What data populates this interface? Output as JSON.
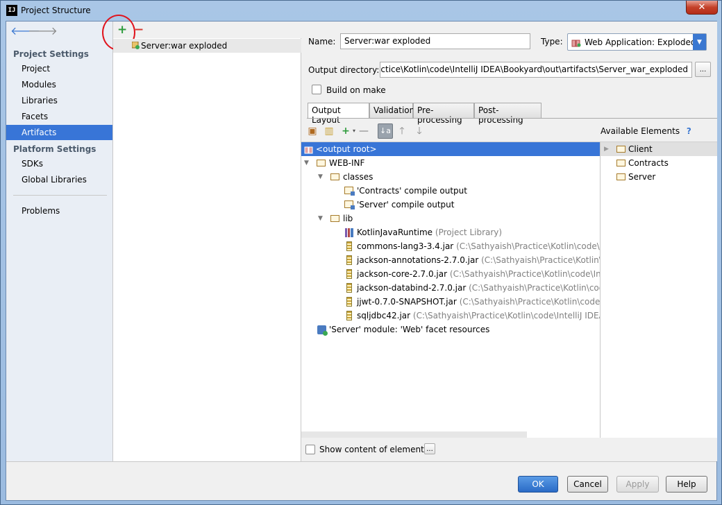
{
  "window": {
    "title": "Project Structure",
    "app_icon": "IJ",
    "close": "✕"
  },
  "sidebar": {
    "back_icon": "🡐",
    "forward_icon": "🡒",
    "project_settings_title": "Project Settings",
    "project_items": [
      {
        "label": "Project"
      },
      {
        "label": "Modules"
      },
      {
        "label": "Libraries"
      },
      {
        "label": "Facets"
      },
      {
        "label": "Artifacts",
        "selected": true
      }
    ],
    "platform_settings_title": "Platform Settings",
    "platform_items": [
      {
        "label": "SDKs"
      },
      {
        "label": "Global Libraries"
      }
    ],
    "problems_label": "Problems"
  },
  "artifacts_list": {
    "add_icon": "+",
    "remove_icon": "−",
    "items": [
      {
        "label": "Server:war exploded"
      }
    ]
  },
  "details": {
    "name_label": "Name:",
    "name_value": "Server:war exploded",
    "type_label": "Type:",
    "type_value": "Web Application: Exploded",
    "output_dir_label": "Output directory:",
    "output_dir_value": "aish\\Practice\\Kotlin\\code\\IntelliJ IDEA\\Bookyard\\out\\artifacts\\Server_war_exploded",
    "browse_label": "...",
    "build_on_make_label": "Build on make",
    "tabs": [
      {
        "label": "Output Layout",
        "active": true
      },
      {
        "label": "Validation"
      },
      {
        "label": "Pre-processing"
      },
      {
        "label": "Post-processing"
      }
    ]
  },
  "layout_tree": {
    "rows": [
      {
        "label": "<output root>",
        "selected": true,
        "icon": "output-root-icon"
      },
      {
        "label": "WEB-INF",
        "icon": "folder-icon",
        "expanded": true
      },
      {
        "label": "classes",
        "icon": "folder-icon",
        "expanded": true
      },
      {
        "label": "'Contracts' compile output",
        "icon": "module-output-icon"
      },
      {
        "label": "'Server' compile output",
        "icon": "module-output-icon"
      },
      {
        "label": "lib",
        "icon": "folder-icon",
        "expanded": true
      },
      {
        "label": "KotlinJavaRuntime",
        "note": "(Project Library)",
        "icon": "library-icon"
      },
      {
        "label": "commons-lang3-3.4.jar",
        "note": "(C:\\Sathyaish\\Practice\\Kotlin\\code\\IntelliJ",
        "icon": "jar-icon"
      },
      {
        "label": "jackson-annotations-2.7.0.jar",
        "note": "(C:\\Sathyaish\\Practice\\Kotlin\\code\\I",
        "icon": "jar-icon"
      },
      {
        "label": "jackson-core-2.7.0.jar",
        "note": "(C:\\Sathyaish\\Practice\\Kotlin\\code\\IntelliJ ID",
        "icon": "jar-icon"
      },
      {
        "label": "jackson-databind-2.7.0.jar",
        "note": "(C:\\Sathyaish\\Practice\\Kotlin\\code\\Inte",
        "icon": "jar-icon"
      },
      {
        "label": "jjwt-0.7.0-SNAPSHOT.jar",
        "note": "(C:\\Sathyaish\\Practice\\Kotlin\\code\\Intell",
        "icon": "jar-icon"
      },
      {
        "label": "sqljdbc42.jar",
        "note": "(C:\\Sathyaish\\Practice\\Kotlin\\code\\IntelliJ IDEA\\Book",
        "icon": "jar-icon"
      },
      {
        "label": "'Server' module: 'Web' facet resources",
        "icon": "web-facet-icon"
      }
    ]
  },
  "available_elements": {
    "title": "Available Elements",
    "help_icon": "?",
    "items": [
      {
        "label": "Client",
        "selected": true
      },
      {
        "label": "Contracts"
      },
      {
        "label": "Server"
      }
    ]
  },
  "show_content": {
    "label": "Show content of elements",
    "more_label": "..."
  },
  "buttons": {
    "ok": "OK",
    "cancel": "Cancel",
    "apply": "Apply",
    "help": "Help"
  },
  "colors": {
    "selection": "#3875d7",
    "annotation_circle": "#e0141d",
    "add_green": "#2e9b3c",
    "remove_red": "#d53a30"
  }
}
